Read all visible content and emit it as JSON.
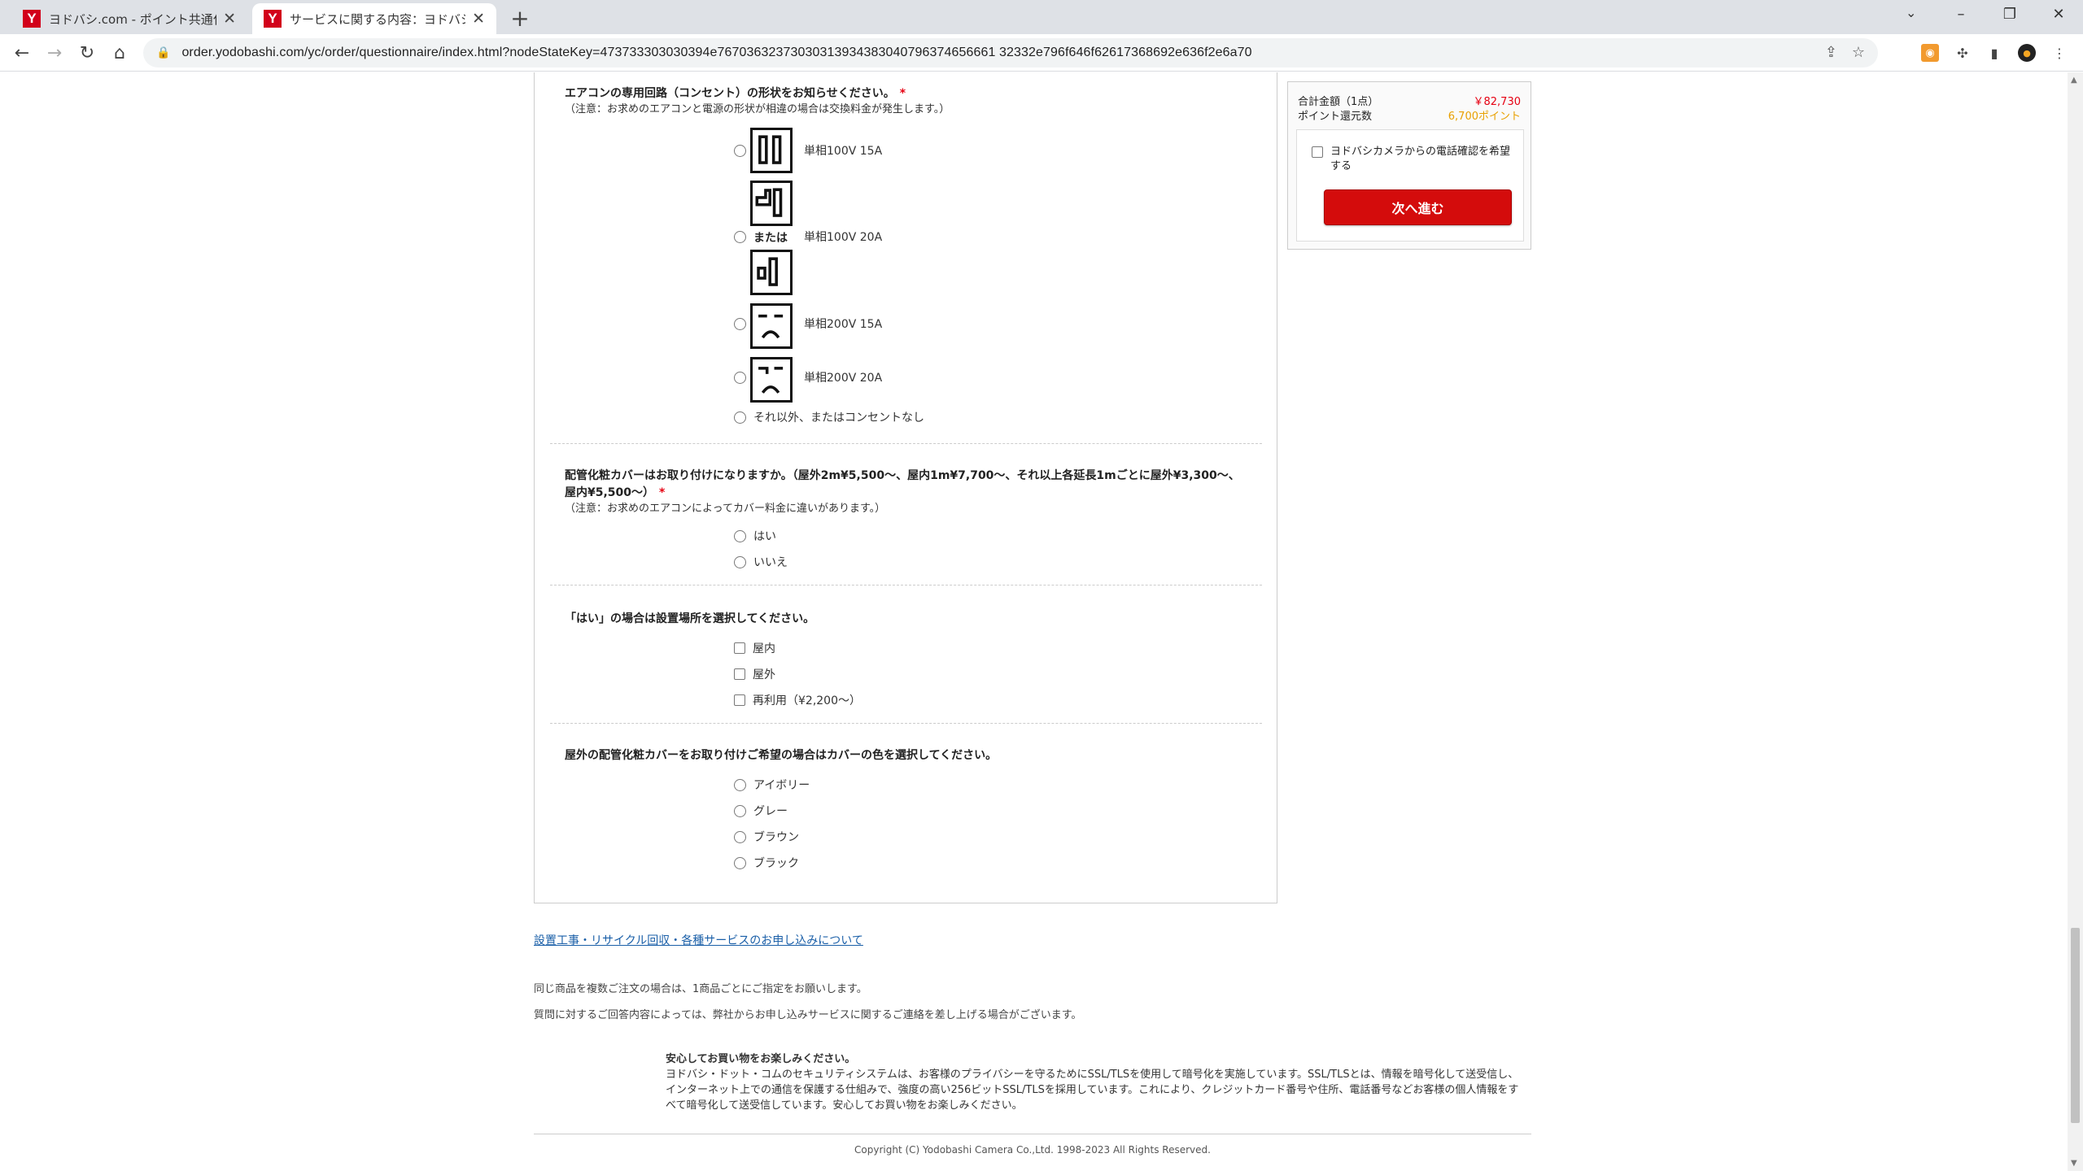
{
  "browser": {
    "tabs": [
      {
        "title": "ヨドバシ.com - ポイント共通化手続き"
      },
      {
        "title": "サービスに関する内容：ヨドバシ・ドット"
      }
    ],
    "url": "order.yodobashi.com/yc/order/questionnaire/index.html?nodeStateKey=473733303030394e767036323730303139343830407963746566613233 2e796f646f62617368692e636f2e6a70",
    "url_display": "order.yodobashi.com/yc/order/questionnaire/index.html?nodeStateKey=473733303030394e76703632373030313934383040796374656661 32332e796f646f62617368692e636f2e6a70"
  },
  "q1": {
    "title": "エアコンの専用回路（コンセント）の形状をお知らせください。",
    "required": "*",
    "note": "（注意：お求めのエアコンと電源の形状が相違の場合は交換料金が発生します。）",
    "options": [
      "単相100V 15A",
      "単相100V 20A",
      "単相200V 15A",
      "単相200V 20A",
      "それ以外、またはコンセントなし"
    ],
    "or_label": "または"
  },
  "q2": {
    "title": "配管化粧カバーはお取り付けになりますか。（屋外2m¥5,500～、屋内1m¥7,700～、それ以上各延長1mごとに屋外¥3,300～、屋内¥5,500～）",
    "required": "*",
    "note": "（注意：お求めのエアコンによってカバー料金に違いがあります。）",
    "options": [
      "はい",
      "いいえ"
    ]
  },
  "q3": {
    "title": "「はい」の場合は設置場所を選択してください。",
    "options": [
      "屋内",
      "屋外",
      "再利用（¥2,200～）"
    ]
  },
  "q4": {
    "title": "屋外の配管化粧カバーをお取り付けご希望の場合はカバーの色を選択してください。",
    "options": [
      "アイボリー",
      "グレー",
      "ブラウン",
      "ブラック"
    ]
  },
  "sidebar": {
    "total_label": "合計金額（1点）",
    "total_value": "￥82,730",
    "points_label": "ポイント還元数",
    "points_value": "6,700ポイント",
    "phone_confirm": "ヨドバシカメラからの電話確認を希望する",
    "next_button": "次へ進む"
  },
  "footer": {
    "link": "設置工事・リサイクル回収・各種サービスのお申し込みについて",
    "text1": "同じ商品を複数ご注文の場合は、1商品ごとにご指定をお願いします。",
    "text2": "質問に対するご回答内容によっては、弊社からお申し込みサービスに関するご連絡を差し上げる場合がございます。",
    "secure_title": "安心してお買い物をお楽しみください。",
    "secure_body": "ヨドバシ・ドット・コムのセキュリティシステムは、お客様のプライバシーを守るためにSSL/TLSを使用して暗号化を実施しています。SSL/TLSとは、情報を暗号化して送受信し、インターネット上での通信を保護する仕組みで、強度の高い256ビットSSL/TLSを採用しています。これにより、クレジットカード番号や住所、電話番号などお客様の個人情報をすべて暗号化して送受信しています。安心してお買い物をお楽しみください。",
    "copyright": "Copyright (C) Yodobashi Camera Co.,Ltd. 1998-2023 All Rights Reserved."
  },
  "colors": {
    "accent": "#d40c0c",
    "price": "#e60012",
    "points": "#e8a000",
    "link": "#1a5fa8"
  }
}
